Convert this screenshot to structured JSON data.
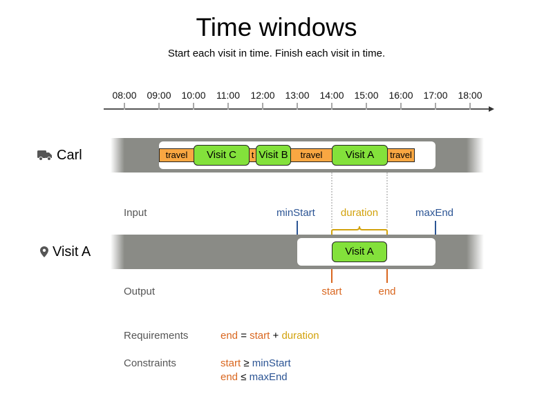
{
  "header": {
    "title": "Time windows",
    "subtitle": "Start each visit in time. Finish each visit in time."
  },
  "timeline": {
    "ticks": [
      "08:00",
      "09:00",
      "10:00",
      "11:00",
      "12:00",
      "13:00",
      "14:00",
      "15:00",
      "16:00",
      "17:00",
      "18:00"
    ]
  },
  "colors": {
    "travel": "#f9a742",
    "visit": "#83e13b",
    "band": "#8a8b86",
    "input_blue": "#2b5494",
    "output_orange": "#d9661e",
    "duration_gold": "#d2a20c"
  },
  "vehicle_row": {
    "icon": "truck-icon",
    "label": "Carl",
    "time_window": {
      "start": "09:00",
      "end": "17:00"
    },
    "segments": [
      {
        "type": "travel",
        "label": "travel",
        "start": "09:00",
        "end": "10:00"
      },
      {
        "type": "visit",
        "label": "Visit C",
        "start": "10:00",
        "end": "11:36"
      },
      {
        "type": "travel",
        "label": "t",
        "start": "11:36",
        "end": "11:48"
      },
      {
        "type": "visit",
        "label": "Visit B",
        "start": "11:48",
        "end": "12:48"
      },
      {
        "type": "travel",
        "label": "travel",
        "start": "12:48",
        "end": "14:00"
      },
      {
        "type": "visit",
        "label": "Visit A",
        "start": "14:00",
        "end": "15:36"
      },
      {
        "type": "travel",
        "label": "travel",
        "start": "15:36",
        "end": "16:24"
      }
    ]
  },
  "visit_row": {
    "icon": "map-pin-icon",
    "label": "Visit A",
    "visit_label": "Visit A",
    "input_label": "Input",
    "output_label": "Output",
    "min_start_label": "minStart",
    "max_end_label": "maxEnd",
    "duration_label": "duration",
    "start_label": "start",
    "end_label": "end"
  },
  "rules": {
    "requirements_label": "Requirements",
    "requirement": {
      "lhs": "end",
      "eq": "=",
      "a": "start",
      "plus": "+",
      "b": "duration"
    },
    "constraints_label": "Constraints",
    "constraint1": {
      "lhs": "start",
      "op": "≥",
      "rhs": "minStart"
    },
    "constraint2": {
      "lhs": "end",
      "op": "≤",
      "rhs": "maxEnd"
    }
  }
}
